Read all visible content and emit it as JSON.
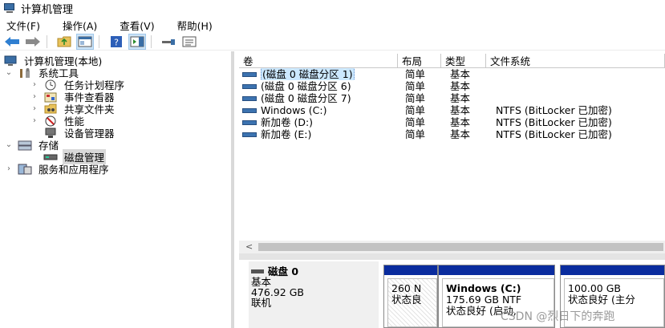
{
  "window": {
    "title": "计算机管理"
  },
  "menu": [
    "文件(F)",
    "操作(A)",
    "查看(V)",
    "帮助(H)"
  ],
  "toolbar": {
    "buttons": [
      "back",
      "forward",
      "up-folder",
      "show-hide-tree",
      "help",
      "show-hide-action-pane",
      "connect",
      "properties"
    ]
  },
  "tree": {
    "root": "计算机管理(本地)",
    "groups": [
      {
        "label": "系统工具",
        "expanded": true,
        "children": [
          "任务计划程序",
          "事件查看器",
          "共享文件夹",
          "性能",
          "设备管理器"
        ]
      },
      {
        "label": "存储",
        "expanded": true,
        "children": [
          "磁盘管理"
        ]
      },
      {
        "label": "服务和应用程序",
        "expanded": false,
        "children": []
      }
    ],
    "selected": "磁盘管理"
  },
  "volumes": {
    "columns": [
      "卷",
      "布局",
      "类型",
      "文件系统"
    ],
    "rows": [
      {
        "name": "(磁盘 0 磁盘分区 1)",
        "layout": "简单",
        "type": "基本",
        "fs": ""
      },
      {
        "name": "(磁盘 0 磁盘分区 6)",
        "layout": "简单",
        "type": "基本",
        "fs": ""
      },
      {
        "name": "(磁盘 0 磁盘分区 7)",
        "layout": "简单",
        "type": "基本",
        "fs": ""
      },
      {
        "name": "Windows (C:)",
        "layout": "简单",
        "type": "基本",
        "fs": "NTFS (BitLocker 已加密)"
      },
      {
        "name": "新加卷 (D:)",
        "layout": "简单",
        "type": "基本",
        "fs": "NTFS (BitLocker 已加密)"
      },
      {
        "name": "新加卷 (E:)",
        "layout": "简单",
        "type": "基本",
        "fs": "NTFS (BitLocker 已加密)"
      }
    ],
    "scroll_left_arrow": "<"
  },
  "disk": {
    "name": "磁盘 0",
    "type": "基本",
    "size": "476.92 GB",
    "status": "联机",
    "partitions": [
      {
        "name": "",
        "size": "260 N",
        "status": "状态良",
        "hatched": true
      },
      {
        "name": "Windows (C:)",
        "size": "175.69 GB NTF",
        "status": "状态良好 (启动,",
        "hatched": false
      },
      {
        "name": "",
        "size": "100.00 GB",
        "status": "状态良好 (主分",
        "hatched": false
      }
    ]
  },
  "watermark": "CSDN @烈日下的奔跑",
  "colors": {
    "partition_bar": "#0a2c9e",
    "selection": "#cce8ff",
    "volume_icon": "#3c73b0"
  }
}
